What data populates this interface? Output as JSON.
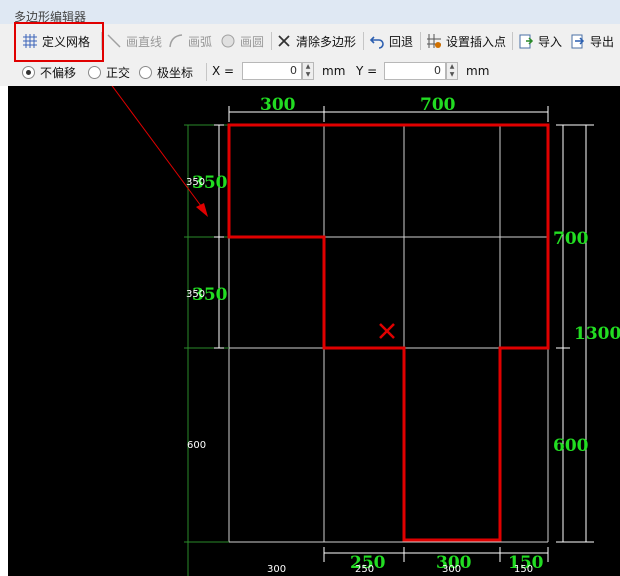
{
  "window": {
    "title": "多边形编辑器"
  },
  "toolbar": {
    "define_grid": "定义网格",
    "draw_line": "画直线",
    "draw_arc": "画弧",
    "draw_circle": "画圆",
    "clear_polygon": "清除多边形",
    "undo": "回退",
    "set_insert_point": "设置插入点",
    "import": "导入",
    "export": "导出"
  },
  "options": {
    "no_offset": "不偏移",
    "orthogonal": "正交",
    "polar": "极坐标",
    "x_label": "X =",
    "x_value": "0",
    "x_unit": "mm",
    "y_label": "Y =",
    "y_value": "0",
    "y_unit": "mm"
  },
  "drawing": {
    "top_dims": [
      "300",
      "700"
    ],
    "left_dims_green": [
      "350",
      "350"
    ],
    "left_dims_white": [
      "350",
      "350",
      "600"
    ],
    "right_dims": [
      "700",
      "1300",
      "600"
    ],
    "bottom_dims_green": [
      "250",
      "300",
      "150"
    ],
    "bottom_dims_white": [
      "300",
      "250",
      "300",
      "150"
    ],
    "colors": {
      "polygon": "#e00000",
      "dimension": "#22dd22",
      "grid": "#cfcfcf",
      "annotation": "#e00000"
    }
  }
}
